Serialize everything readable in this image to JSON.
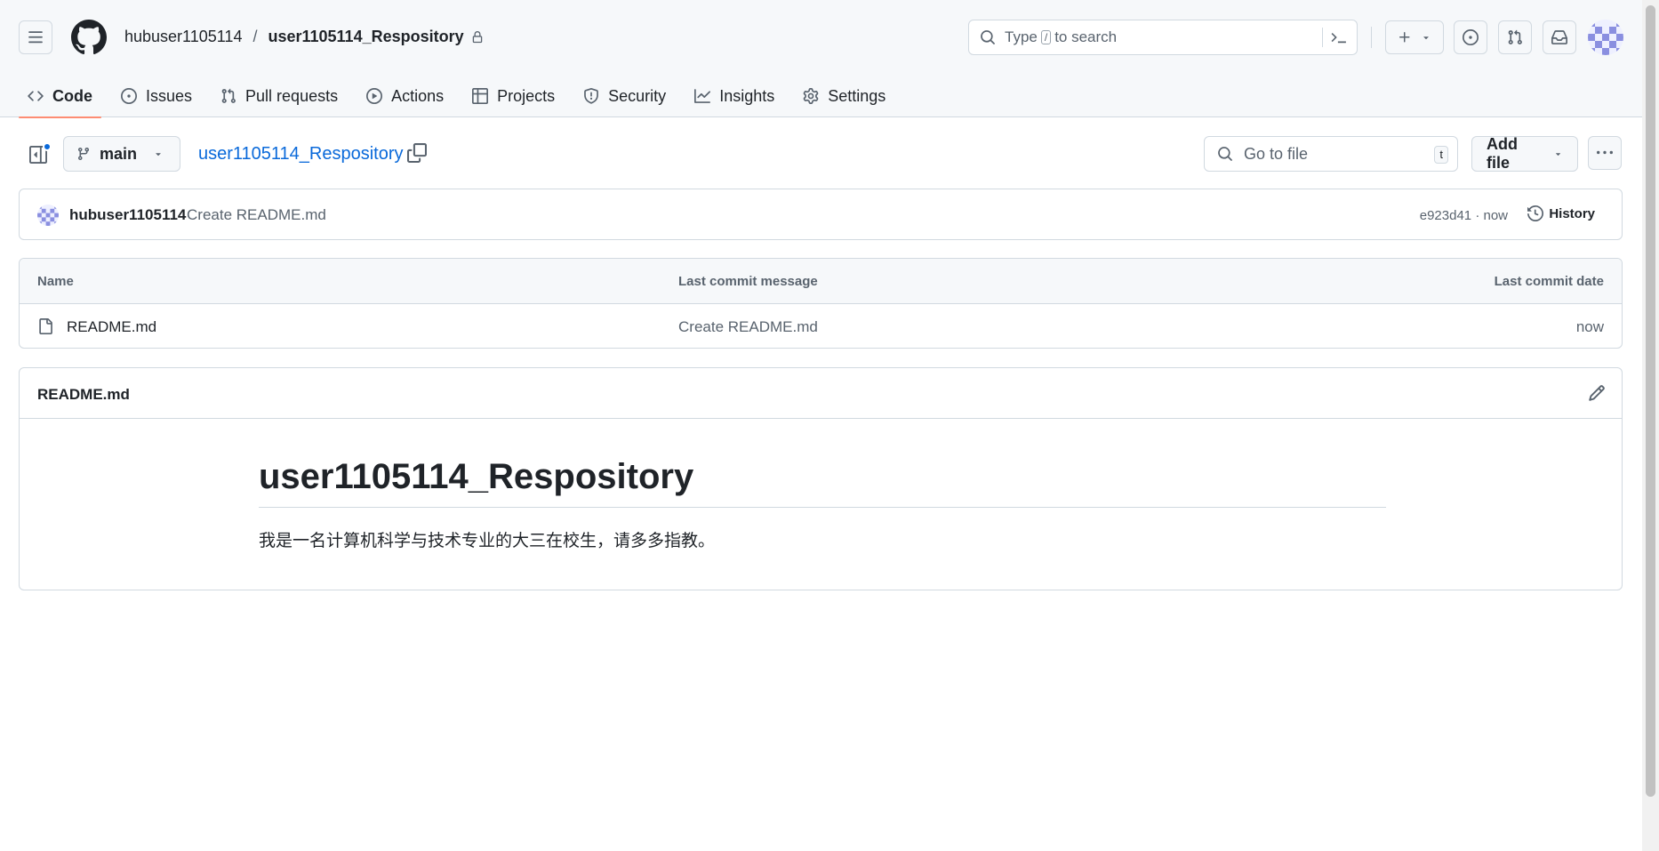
{
  "header": {
    "owner": "hubuser1105114",
    "separator": "/",
    "repo": "user1105114_Respository",
    "search": {
      "prefix": "Type",
      "key": "/",
      "suffix": "to search"
    }
  },
  "tabs": [
    {
      "label": "Code",
      "icon": "code-icon",
      "active": true
    },
    {
      "label": "Issues",
      "icon": "issue-opened-icon"
    },
    {
      "label": "Pull requests",
      "icon": "git-pull-request-icon"
    },
    {
      "label": "Actions",
      "icon": "play-icon"
    },
    {
      "label": "Projects",
      "icon": "table-icon"
    },
    {
      "label": "Security",
      "icon": "shield-icon"
    },
    {
      "label": "Insights",
      "icon": "graph-icon"
    },
    {
      "label": "Settings",
      "icon": "gear-icon"
    }
  ],
  "toolbar": {
    "branch": "main",
    "repo_link": "user1105114_Respository",
    "goto_placeholder": "Go to file",
    "goto_key": "t",
    "add_file": "Add file"
  },
  "commit": {
    "author": "hubuser1105114",
    "message": "Create README.md",
    "meta": "e923d41 · now",
    "history": "History"
  },
  "files": {
    "columns": {
      "name": "Name",
      "message": "Last commit message",
      "date": "Last commit date"
    },
    "rows": [
      {
        "name": "README.md",
        "message": "Create README.md",
        "date": "now"
      }
    ]
  },
  "readme": {
    "title": "README.md",
    "heading": "user1105114_Respository",
    "paragraph": "我是一名计算机科学与技术专业的大三在校生，请多多指教。"
  },
  "colors": {
    "accent": "#0969da",
    "active_tab_underline": "#fd8c73",
    "header_bg": "#f6f8fa",
    "border": "#d1d9e0"
  }
}
